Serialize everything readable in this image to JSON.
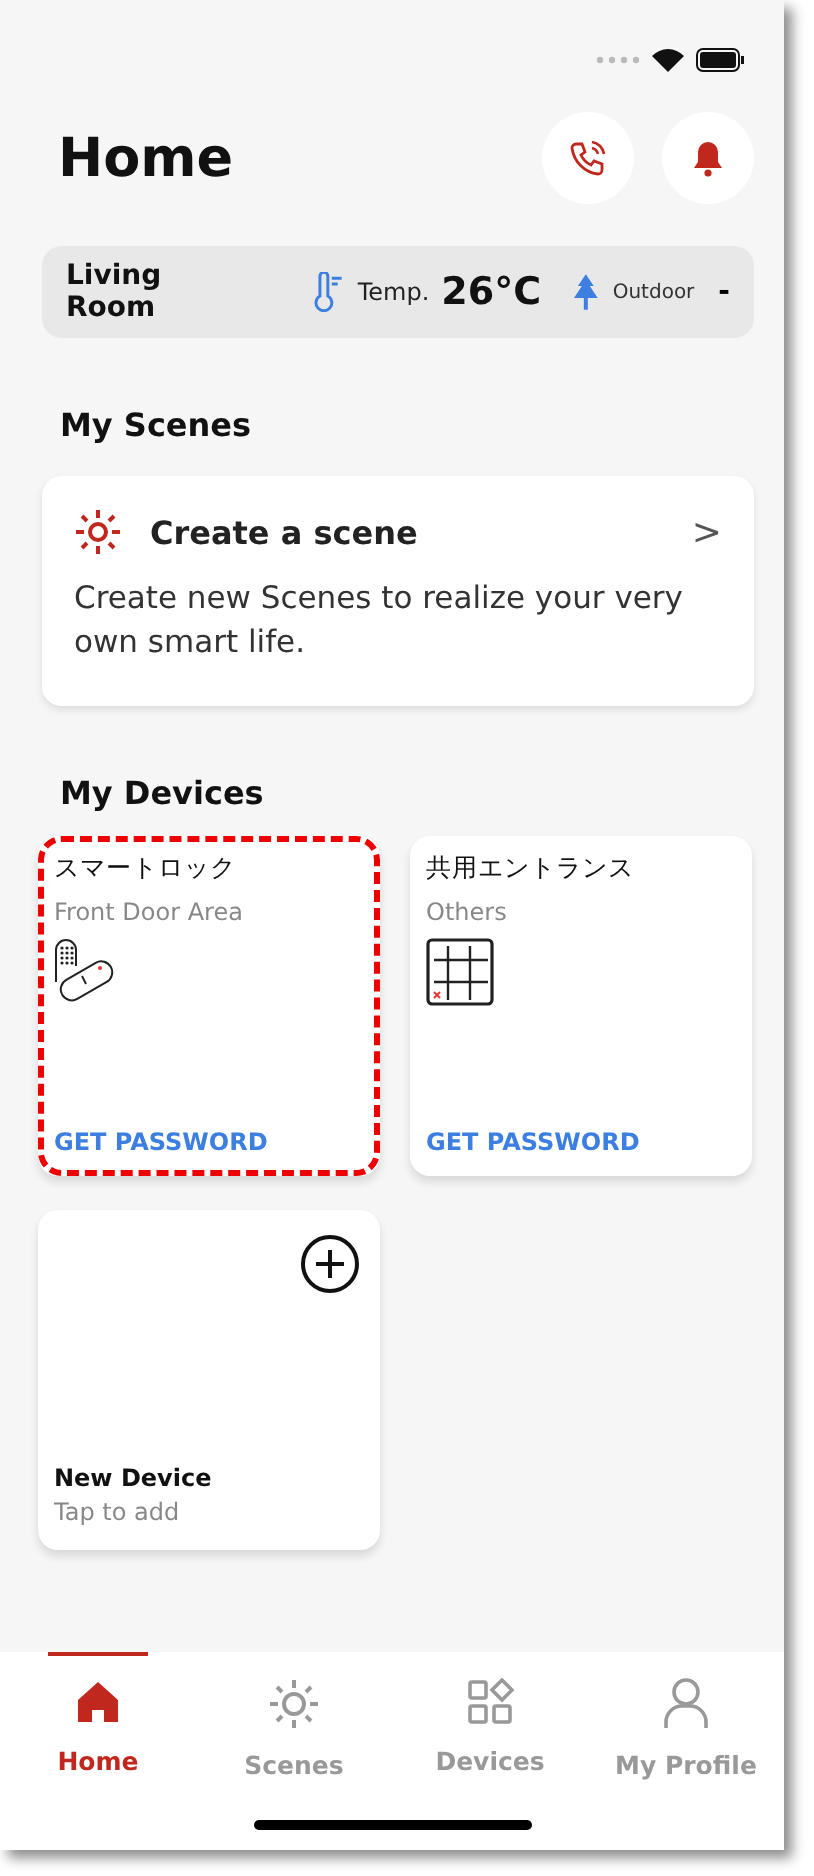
{
  "header": {
    "title": "Home"
  },
  "header_buttons": [
    {
      "kind": "call"
    },
    {
      "kind": "bell"
    }
  ],
  "weather": {
    "room": "Living Room",
    "temp_label": "Temp.",
    "temp": "26°C",
    "outdoor_label": "Outdoor",
    "outdoor": "-"
  },
  "scenes": {
    "heading": "My Scenes",
    "card_title": "Create a scene",
    "card_text": "Create new Scenes to realize your very own smart life.",
    "chevron": ">"
  },
  "devices": {
    "heading": "My Devices",
    "items": [
      {
        "name": "スマートロック",
        "area": "Front Door Area",
        "kind": "lock",
        "action": "GET PASSWORD",
        "highlighted": true
      },
      {
        "name": "共用エントランス",
        "area": "Others",
        "kind": "panel",
        "action": "GET PASSWORD",
        "highlighted": false
      }
    ],
    "add": {
      "title": "New Device",
      "subtitle": "Tap to add"
    }
  },
  "tabs": [
    {
      "label": "Home",
      "kind": "home",
      "selected": true
    },
    {
      "label": "Scenes",
      "kind": "scenes",
      "selected": false
    },
    {
      "label": "Devices",
      "kind": "devices",
      "selected": false
    },
    {
      "label": "My Profile",
      "kind": "profile",
      "selected": false
    }
  ]
}
